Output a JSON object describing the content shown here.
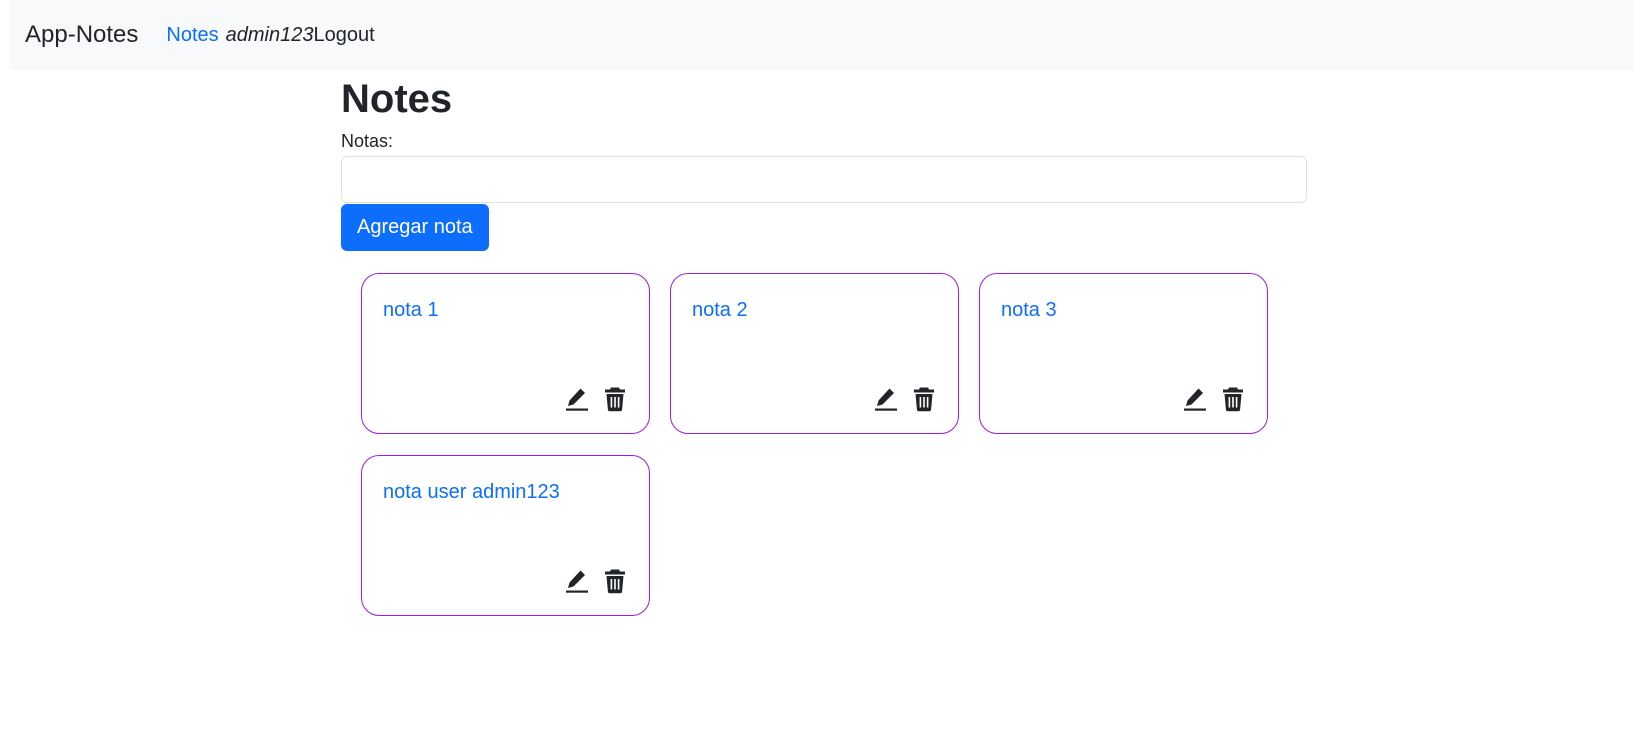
{
  "navbar": {
    "brand": "App-Notes",
    "notes_link": "Notes",
    "username": "admin123",
    "logout_label": "Logout"
  },
  "main": {
    "title": "Notes",
    "input_label": "Notas:",
    "input_value": "",
    "add_button_label": "Agregar nota"
  },
  "notes": [
    {
      "title": "nota 1",
      "edit_icon": "pencil-icon",
      "delete_icon": "trash-icon"
    },
    {
      "title": "nota 2",
      "edit_icon": "pencil-icon",
      "delete_icon": "trash-icon"
    },
    {
      "title": "nota 3",
      "edit_icon": "pencil-icon",
      "delete_icon": "trash-icon"
    },
    {
      "title": "nota user admin123",
      "edit_icon": "pencil-icon",
      "delete_icon": "trash-icon"
    }
  ],
  "colors": {
    "navbar_bg": "#f8f9fa",
    "primary": "#0d6efd",
    "card_border": "#9d1bf0",
    "text": "#212529"
  }
}
